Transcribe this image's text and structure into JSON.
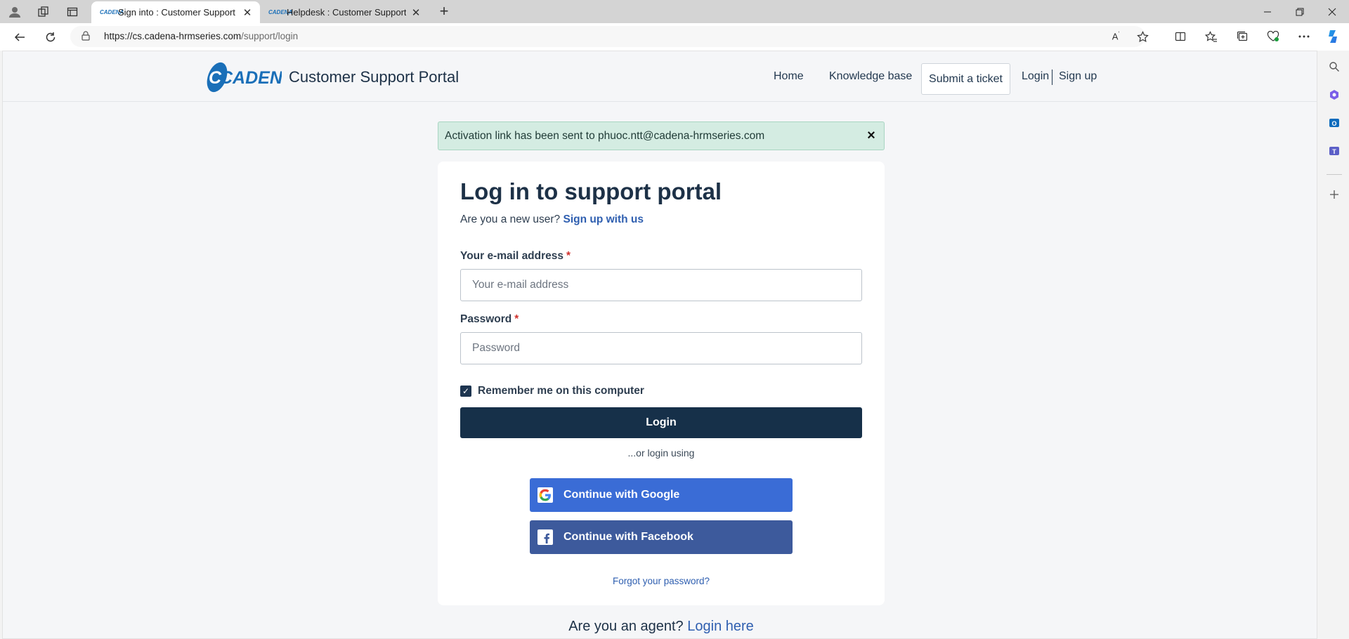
{
  "browser": {
    "tabs": [
      {
        "title": "Sign into : Customer Support Po",
        "favicon": "CADENA",
        "active": true
      },
      {
        "title": "Helpdesk : Customer Support Po",
        "favicon": "CADENA",
        "active": false
      }
    ],
    "url_host": "https://cs.cadena-hrmseries.com",
    "url_path": "/support/login",
    "icons": {
      "profile": "profile-icon",
      "workspaces": "workspaces-icon",
      "tab_actions": "tab-actions-icon",
      "new_tab": "+",
      "back": "back-icon",
      "refresh": "refresh-icon",
      "read_aloud": "read-aloud-icon",
      "favorite": "star-icon",
      "split": "split-screen-icon",
      "favorites": "favorites-icon",
      "collections": "collections-icon",
      "performance": "heart-icon",
      "more": "more-icon",
      "copilot": "copilot-icon"
    }
  },
  "site": {
    "logo_text": "CADENA",
    "portal_title": "Customer Support Portal",
    "nav": {
      "home": "Home",
      "kb": "Knowledge base",
      "submit": "Submit a ticket",
      "login": "Login",
      "signup": "Sign up"
    }
  },
  "alert": {
    "message": "Activation link has been sent to phuoc.ntt@cadena-hrmseries.com",
    "close": "×"
  },
  "login": {
    "heading": "Log in to support portal",
    "new_user_prefix": "Are you a new user?",
    "signup_link": "Sign up with us",
    "email_label": "Your e-mail address",
    "email_placeholder": "Your e-mail address",
    "password_label": "Password",
    "password_placeholder": "Password",
    "required_mark": "*",
    "remember_label": "Remember me on this computer",
    "remember_checked": true,
    "login_button": "Login",
    "or_login": "...or login using",
    "google_button": "Continue with Google",
    "facebook_button": "Continue with Facebook",
    "forgot": "Forgot your password?"
  },
  "agent": {
    "prefix": "Are you an agent?",
    "link": "Login here"
  },
  "colors": {
    "primary_dark": "#163049",
    "link": "#2f5fb0",
    "google": "#3a6cd6",
    "facebook": "#3d5a9c",
    "alert_bg": "#d4ece2"
  }
}
